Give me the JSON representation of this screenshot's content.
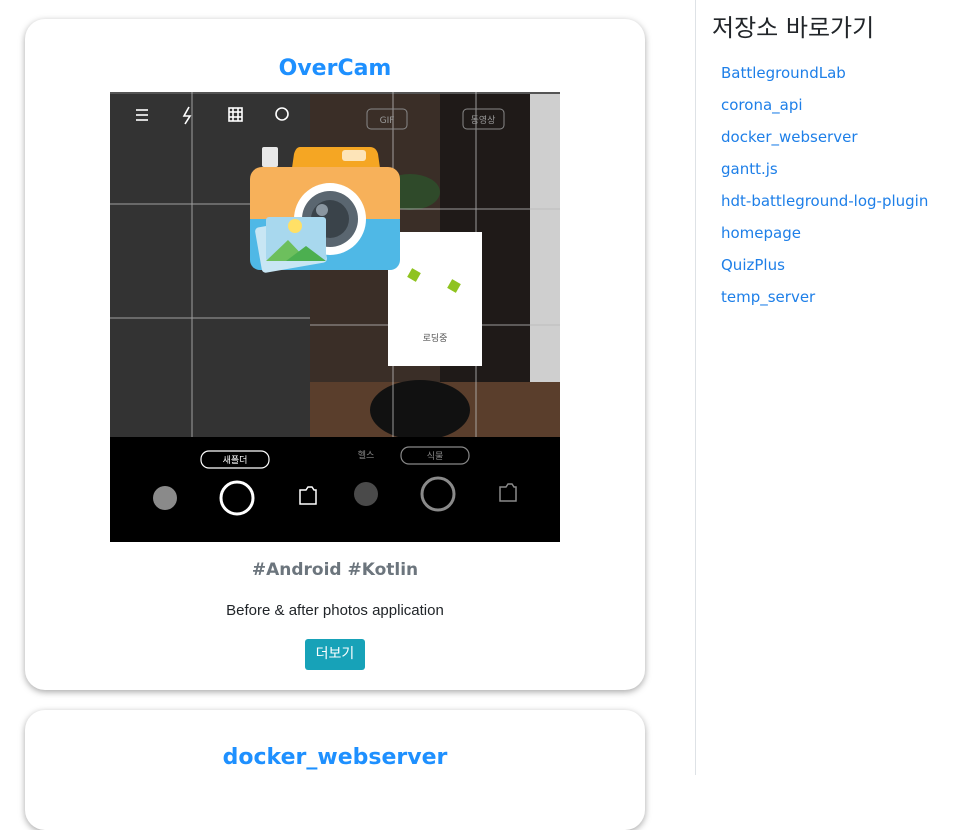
{
  "projects": [
    {
      "title": "OverCam",
      "tags": "#Android #Kotlin",
      "description": "Before & after photos application",
      "more_label": "더보기",
      "screenshot": {
        "top_left_buttons": [
          "list-icon",
          "flash-icon",
          "grid-icon",
          "filter-icon"
        ],
        "top_right_chips": [
          "GIF",
          "동영상"
        ],
        "loading_text": "로딩중",
        "left_mode": "새폴더",
        "right_modes": [
          "헬스",
          "식물"
        ]
      }
    },
    {
      "title": "docker_webserver"
    }
  ],
  "sidebar": {
    "heading": "저장소 바로가기",
    "links": [
      "BattlegroundLab",
      "corona_api",
      "docker_webserver",
      "gantt.js",
      "hdt-battleground-log-plugin",
      "homepage",
      "QuizPlus",
      "temp_server"
    ]
  }
}
